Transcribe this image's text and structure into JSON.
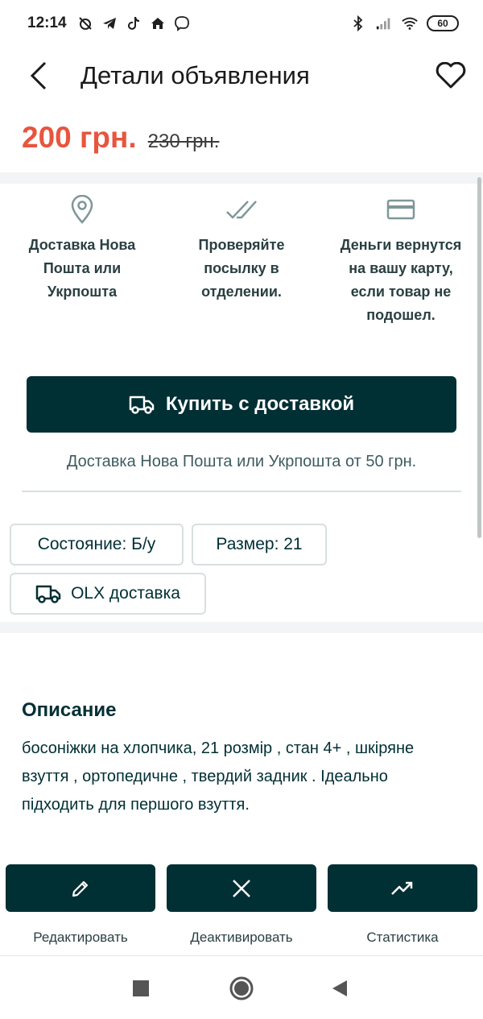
{
  "status_bar": {
    "time": "12:14",
    "left_icons": [
      "muted-alarm-icon",
      "telegram-icon",
      "tiktok-icon",
      "home-icon",
      "viber-icon"
    ],
    "right_icons": [
      "bluetooth-icon",
      "signal-icon",
      "wifi-icon"
    ],
    "battery": "60"
  },
  "header": {
    "title": "Детали объявления"
  },
  "price": {
    "current": "200 грн.",
    "old": "230 грн."
  },
  "features": [
    {
      "icon": "location-pin-icon",
      "text": "Доставка Нова Пошта или Укрпошта"
    },
    {
      "icon": "double-check-icon",
      "text": "Проверяйте посылку в отделении."
    },
    {
      "icon": "card-icon",
      "text": "Деньги вернутся на вашу карту, если товар не подошел."
    }
  ],
  "buy_button": {
    "label": "Купить с доставкой"
  },
  "delivery_note": "Доставка Нова Пошта или Укрпошта от 50 грн.",
  "chips": {
    "condition": "Состояние: Б/у",
    "size": "Размер: 21",
    "olx_delivery": "OLX доставка"
  },
  "description": {
    "title": "Описание",
    "text": "босоніжки на хлопчика, 21 розмір , стан 4+ , шкіряне взуття , ортопедичне , твердий задник . Ідеально підходить для першого взуття."
  },
  "actions": {
    "edit": "Редактировать",
    "deactivate": "Деактивировать",
    "stats": "Статистика"
  },
  "colors": {
    "accent_dark": "#002f34",
    "price": "#e8553e"
  }
}
